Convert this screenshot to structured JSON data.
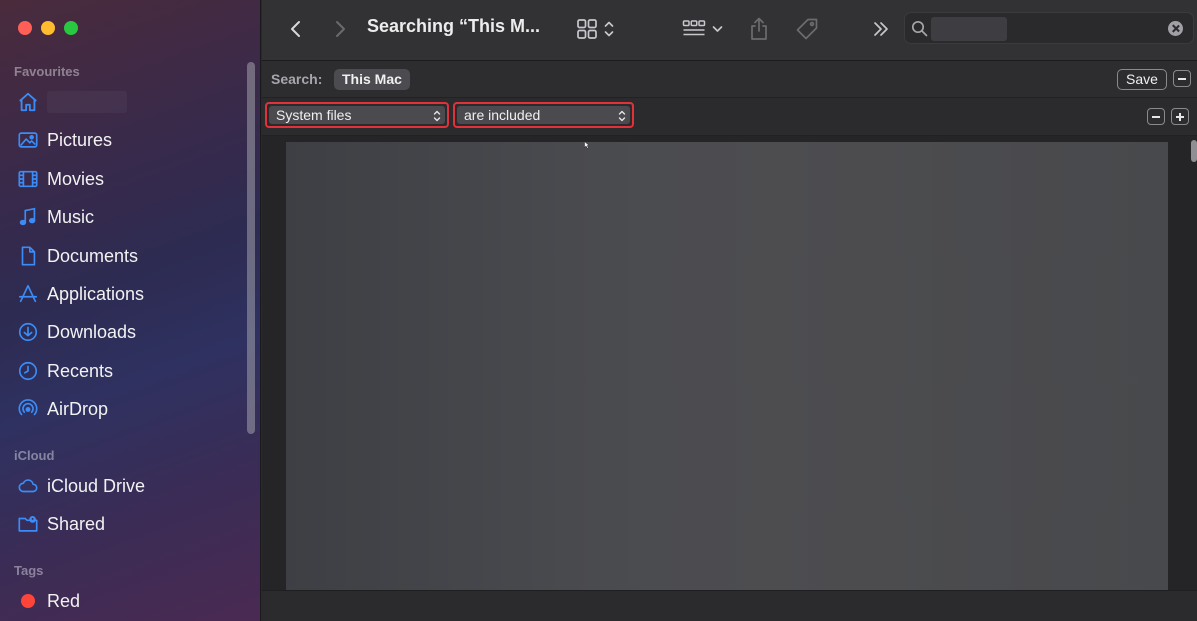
{
  "window": {
    "title": "Searching “This M..."
  },
  "sidebar": {
    "sections": [
      {
        "label": "Favourites"
      },
      {
        "label": "iCloud"
      },
      {
        "label": "Tags"
      }
    ],
    "favourites": [
      {
        "label": "",
        "icon": "home-icon"
      },
      {
        "label": "Pictures",
        "icon": "photo-icon"
      },
      {
        "label": "Movies",
        "icon": "film-icon"
      },
      {
        "label": "Music",
        "icon": "music-note-icon"
      },
      {
        "label": "Documents",
        "icon": "document-icon"
      },
      {
        "label": "Applications",
        "icon": "applications-icon"
      },
      {
        "label": "Downloads",
        "icon": "download-icon"
      },
      {
        "label": "Recents",
        "icon": "clock-icon"
      },
      {
        "label": "AirDrop",
        "icon": "airdrop-icon"
      }
    ],
    "icloud": [
      {
        "label": "iCloud Drive",
        "icon": "cloud-icon"
      },
      {
        "label": "Shared",
        "icon": "shared-folder-icon"
      }
    ],
    "tags": [
      {
        "label": "Red",
        "color": "#ff453a"
      }
    ]
  },
  "scope": {
    "label": "Search:",
    "selected": "This Mac",
    "save_label": "Save"
  },
  "criteria": {
    "attribute": "System files",
    "condition": "are included"
  },
  "colors": {
    "highlight": "#e0323a",
    "accent": "#3b82f6"
  }
}
